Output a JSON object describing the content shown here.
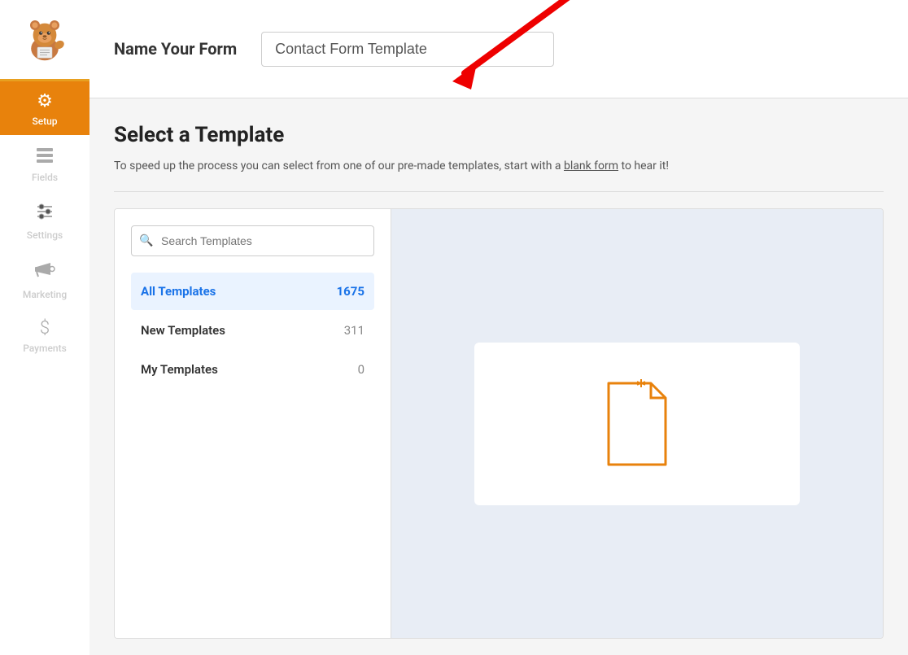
{
  "sidebar": {
    "items": [
      {
        "id": "setup",
        "label": "Setup",
        "icon": "⚙",
        "active": true
      },
      {
        "id": "fields",
        "label": "Fields",
        "icon": "▤"
      },
      {
        "id": "settings",
        "label": "Settings",
        "icon": "⚌"
      },
      {
        "id": "marketing",
        "label": "Marketing",
        "icon": "📣"
      },
      {
        "id": "payments",
        "label": "Payments",
        "icon": "$"
      }
    ]
  },
  "top_bar": {
    "form_name_label": "Name Your Form",
    "form_name_value": "Contact Form Template"
  },
  "content": {
    "section_title": "Select a Template",
    "section_desc_part1": "To speed up the process you can select from one of our pre-made templates, start with a ",
    "section_desc_link": "blank form",
    "section_desc_part2": " to hear it",
    "section_desc_end": "!"
  },
  "search": {
    "placeholder": "Search Templates"
  },
  "template_categories": [
    {
      "id": "all",
      "label": "All Templates",
      "count": "1675",
      "active": true
    },
    {
      "id": "new",
      "label": "New Templates",
      "count": "311",
      "active": false
    },
    {
      "id": "my",
      "label": "My Templates",
      "count": "0",
      "active": false
    }
  ]
}
